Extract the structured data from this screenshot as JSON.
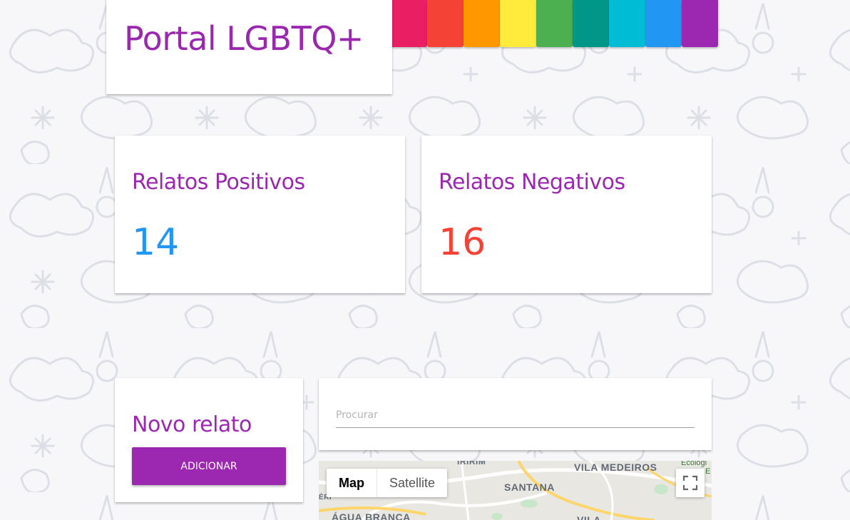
{
  "header": {
    "title": "Portal LGBTQ+",
    "rainbow_colors": [
      "#e91e63",
      "#f44336",
      "#ff9800",
      "#ffeb3b",
      "#4caf50",
      "#009688",
      "#00bcd4",
      "#2196f3",
      "#9c27b0"
    ]
  },
  "stats": {
    "positive": {
      "label": "Relatos Positivos",
      "value": "14",
      "color": "#2196f3"
    },
    "negative": {
      "label": "Relatos Negativos",
      "value": "16",
      "color": "#f44336"
    }
  },
  "new_report": {
    "title": "Novo relato",
    "button_label": "ADICIONAR"
  },
  "search": {
    "placeholder": "Procurar",
    "value": ""
  },
  "map": {
    "type_control": {
      "map_label": "Map",
      "satellite_label": "Satellite",
      "selected": "Map"
    },
    "labels": {
      "vila_medeiros": "VILA MEDEIROS",
      "santana": "SANTANA",
      "agua_branca": "ÁGUA BRANCA",
      "vila": "VILA",
      "top_partial": "IRIRIM",
      "ecologico": "Ecológi",
      "ecologico_2": "e E",
      "left_partial": "ÉRI"
    },
    "fullscreen_icon": "fullscreen-icon"
  },
  "theme": {
    "accent": "#9c27b0"
  }
}
